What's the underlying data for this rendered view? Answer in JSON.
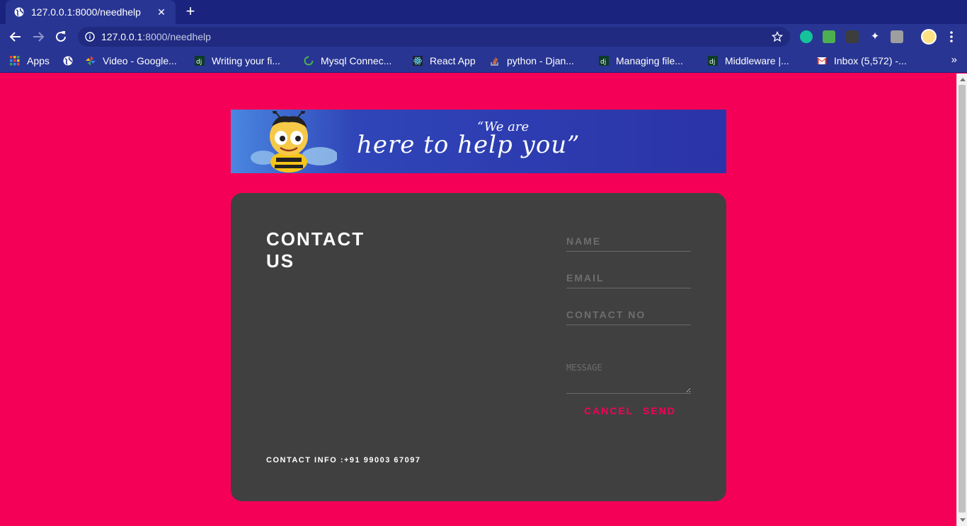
{
  "browser": {
    "tab_title": "127.0.0.1:8000/needhelp",
    "tab_close": "✕",
    "new_tab": "+",
    "url_host": "127.0.0.1",
    "url_path": ":8000/needhelp",
    "bookmarks_overflow": "»",
    "bookmarks": [
      {
        "label": "Apps",
        "icon": "apps-grid-icon"
      },
      {
        "label": "",
        "icon": "globe-icon"
      },
      {
        "label": "Video - Google...",
        "icon": "pinwheel-icon"
      },
      {
        "label": "Writing your fi...",
        "icon": "django-icon"
      },
      {
        "label": "Mysql Connec...",
        "icon": "spinner-icon"
      },
      {
        "label": "React App",
        "icon": "react-icon"
      },
      {
        "label": "python - Djan...",
        "icon": "stackoverflow-icon"
      },
      {
        "label": "Managing file...",
        "icon": "django-icon"
      },
      {
        "label": "Middleware |...",
        "icon": "django-icon"
      },
      {
        "label": "Inbox (5,572) -...",
        "icon": "gmail-icon"
      }
    ]
  },
  "banner": {
    "line1": "“We are",
    "line2": "here to help you”"
  },
  "contact": {
    "heading_line1": "CONTACT",
    "heading_line2": "US",
    "name_placeholder": "NAME",
    "email_placeholder": "EMAIL",
    "phone_placeholder": "CONTACT NO",
    "message_placeholder": "MESSAGE",
    "cancel_label": "CANCEL",
    "send_label": "SEND",
    "info": "CONTACT INFO :+91 99003 67097"
  },
  "colors": {
    "page_background": "#f50057",
    "card_background": "#404040",
    "accent": "#f50057",
    "browser_frame": "#283593"
  }
}
